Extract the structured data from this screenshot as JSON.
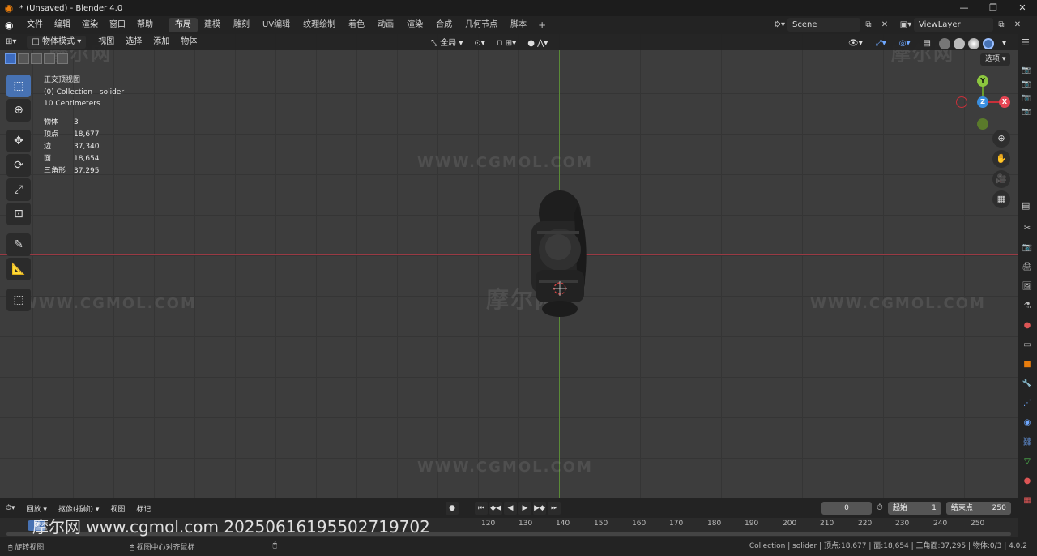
{
  "window": {
    "title": "* (Unsaved) - Blender 4.0"
  },
  "menus": [
    "文件",
    "编辑",
    "渲染",
    "窗口",
    "帮助"
  ],
  "workspaces": [
    {
      "label": "布局",
      "active": true
    },
    {
      "label": "建模"
    },
    {
      "label": "雕刻"
    },
    {
      "label": "UV编辑"
    },
    {
      "label": "纹理绘制"
    },
    {
      "label": "着色"
    },
    {
      "label": "动画"
    },
    {
      "label": "渲染"
    },
    {
      "label": "合成"
    },
    {
      "label": "几何节点"
    },
    {
      "label": "脚本"
    }
  ],
  "scene": {
    "name": "Scene",
    "view_layer": "ViewLayer"
  },
  "viewport_header": {
    "mode": "物体模式",
    "menus": [
      "视图",
      "选择",
      "添加",
      "物体"
    ],
    "transform_orientation": "全局",
    "view_menu_label": "选项"
  },
  "overlay": {
    "view_name": "正交顶视图",
    "collection": "(0) Collection | solider",
    "scale": "10 Centimeters",
    "stats": [
      {
        "label": "物体",
        "value": "3"
      },
      {
        "label": "顶点",
        "value": "18,677"
      },
      {
        "label": "边",
        "value": "37,340"
      },
      {
        "label": "面",
        "value": "18,654"
      },
      {
        "label": "三角形",
        "value": "37,295"
      }
    ]
  },
  "watermark": "WWW.CGMOL.COM",
  "watermark_logo": "摩尔网",
  "gizmo": {
    "x": "X",
    "y": "Y",
    "z": "Z"
  },
  "timeline_header": {
    "menus": [
      "回放",
      "抠像(插帧)",
      "视图",
      "标记"
    ],
    "current_frame": "0",
    "start_label": "起始",
    "start": "1",
    "end_label": "结束点",
    "end": "250"
  },
  "timeline": {
    "current": "0",
    "ticks": [
      "120",
      "130",
      "140",
      "150",
      "160",
      "170",
      "180",
      "190",
      "200",
      "210",
      "220",
      "230",
      "240",
      "250"
    ]
  },
  "overlay_watermark": "摩尔网 www.cgmol.com 20250616195502719702",
  "statusbar": {
    "left": [
      "旋转视图",
      "视图中心对齐鼠标"
    ],
    "right": "Collection | solider | 顶点:18,677 | 面:18,654 | 三角面:37,295 | 物体:0/3 | 4.0.2"
  }
}
